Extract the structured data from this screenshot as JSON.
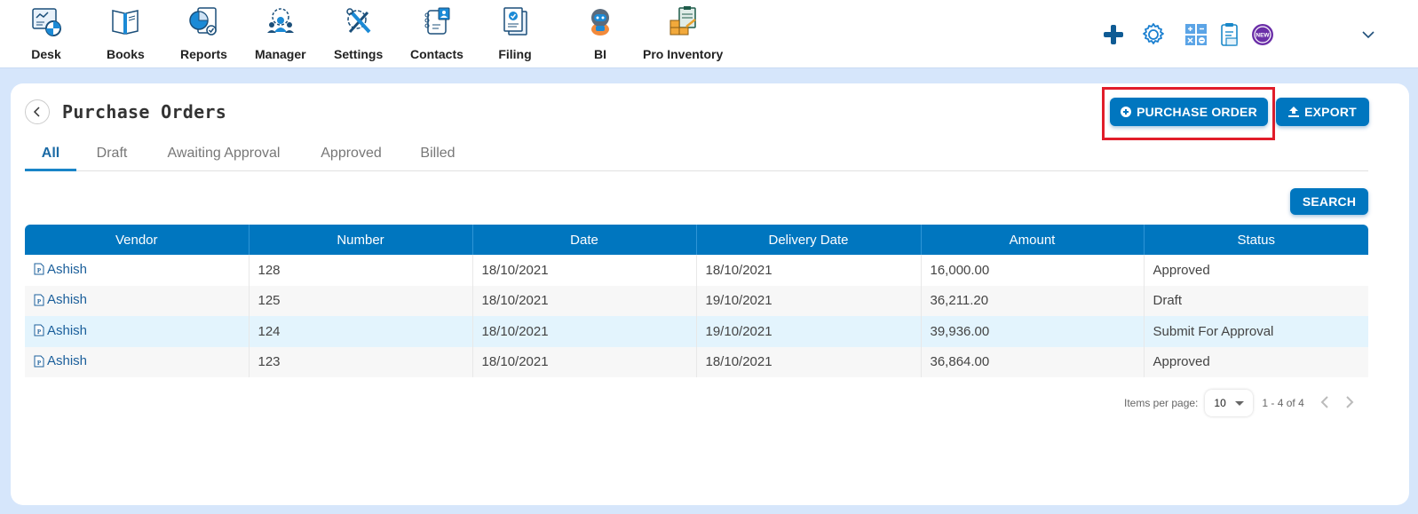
{
  "topnav": {
    "items": [
      {
        "label": "Desk",
        "icon": "desk-icon"
      },
      {
        "label": "Books",
        "icon": "books-icon"
      },
      {
        "label": "Reports",
        "icon": "reports-icon"
      },
      {
        "label": "Manager",
        "icon": "manager-icon"
      },
      {
        "label": "Settings",
        "icon": "settings-icon"
      },
      {
        "label": "Contacts",
        "icon": "contacts-icon"
      },
      {
        "label": "Filing",
        "icon": "filing-icon"
      },
      {
        "label": "BI",
        "icon": "bi-robot-icon"
      },
      {
        "label": "Pro Inventory",
        "icon": "pro-inventory-icon"
      }
    ],
    "tools": [
      "plus-icon",
      "gear-icon",
      "calculator-icon",
      "clipboard-icon",
      "new-badge-icon",
      "chevron-down-icon"
    ],
    "new_badge_text": "NEW"
  },
  "page": {
    "title": "Purchase Orders",
    "tabs": [
      {
        "label": "All",
        "active": true
      },
      {
        "label": "Draft",
        "active": false
      },
      {
        "label": "Awaiting Approval",
        "active": false
      },
      {
        "label": "Approved",
        "active": false
      },
      {
        "label": "Billed",
        "active": false
      }
    ],
    "buttons": {
      "purchase_order": "PURCHASE ORDER",
      "export": "EXPORT",
      "search": "SEARCH"
    }
  },
  "table": {
    "columns": [
      "Vendor",
      "Number",
      "Date",
      "Delivery Date",
      "Amount",
      "Status"
    ],
    "rows": [
      {
        "vendor": "Ashish",
        "number": "128",
        "date": "18/10/2021",
        "delivery_date": "18/10/2021",
        "amount": "16,000.00",
        "status": "Approved"
      },
      {
        "vendor": "Ashish",
        "number": "125",
        "date": "18/10/2021",
        "delivery_date": "19/10/2021",
        "amount": "36,211.20",
        "status": "Draft"
      },
      {
        "vendor": "Ashish",
        "number": "124",
        "date": "18/10/2021",
        "delivery_date": "19/10/2021",
        "amount": "39,936.00",
        "status": "Submit For Approval"
      },
      {
        "vendor": "Ashish",
        "number": "123",
        "date": "18/10/2021",
        "delivery_date": "18/10/2021",
        "amount": "36,864.00",
        "status": "Approved"
      }
    ]
  },
  "pagination": {
    "items_per_page_label": "Items per page:",
    "items_per_page": "10",
    "range": "1 - 4 of 4"
  },
  "colors": {
    "primary": "#0076bf",
    "highlight": "#e11d2a",
    "page_bg": "#d6e6fb"
  }
}
